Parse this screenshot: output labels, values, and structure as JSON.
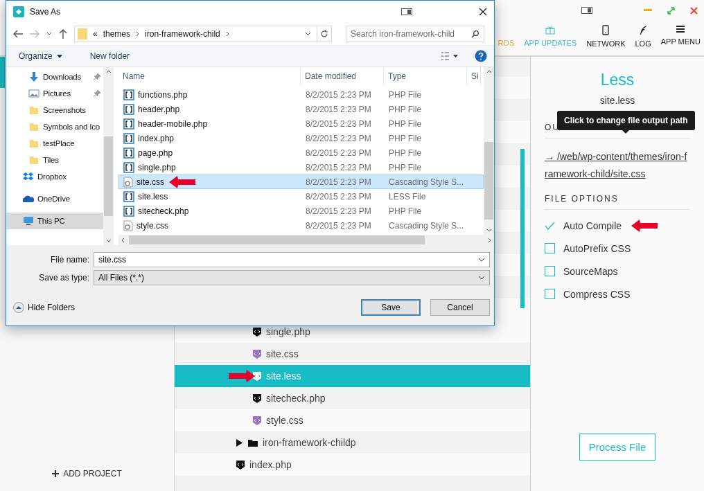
{
  "app": {
    "nav": [
      {
        "label": "ROS",
        "color": "#e0a43c"
      },
      {
        "label": "APP UPDATES",
        "color": "#3fbdc6"
      },
      {
        "label": "NETWORK",
        "color": "#222222"
      },
      {
        "label": "LOG",
        "color": "#222222"
      },
      {
        "label": "APP MENU",
        "color": "#222222"
      }
    ],
    "add_project": "ADD PROJECT",
    "tree": [
      {
        "children": [
          {
            "name": "single.php",
            "kind": "php",
            "selected": false,
            "annotated": false
          },
          {
            "name": "site.css",
            "kind": "css",
            "selected": false,
            "annotated": false
          },
          {
            "name": "site.less",
            "kind": "less",
            "selected": true,
            "annotated": true
          },
          {
            "name": "sitecheck.php",
            "kind": "php",
            "selected": false,
            "annotated": false
          },
          {
            "name": "style.css",
            "kind": "css",
            "selected": false,
            "annotated": false
          }
        ]
      },
      {
        "name": "iron-framework-childp",
        "kind": "folder",
        "expanded": false,
        "selected": false,
        "annotated": false
      },
      {
        "name": "index.php",
        "kind": "php",
        "selected": false,
        "annotated": false
      }
    ],
    "panel": {
      "title": "Less",
      "file": "site.less",
      "output_heading": "OU",
      "tooltip": "Click to change file output path",
      "output_path": "→ /web/wp-content/themes/iron-framework-child/site.css",
      "options_heading": "FILE OPTIONS",
      "options": [
        {
          "label": "Auto Compile",
          "checked": true,
          "annotated": true
        },
        {
          "label": "AutoPrefix CSS",
          "checked": false,
          "annotated": false
        },
        {
          "label": "SourceMaps",
          "checked": false,
          "annotated": false
        },
        {
          "label": "Compress CSS",
          "checked": false,
          "annotated": false
        }
      ],
      "process": "Process File"
    }
  },
  "dialog": {
    "title": "Save As",
    "breadcrumb": {
      "overflow": "«",
      "parts": [
        "themes",
        "iron-framework-child"
      ]
    },
    "search": {
      "placeholder": "Search iron-framework-child"
    },
    "organize": "Organize",
    "new_folder": "New folder",
    "places": [
      {
        "label": "Downloads",
        "kind": "download",
        "pinned": true,
        "selected": false
      },
      {
        "label": "Pictures",
        "kind": "pictures",
        "pinned": true,
        "selected": false
      },
      {
        "label": "Screenshots",
        "kind": "folder",
        "pinned": false,
        "selected": false
      },
      {
        "label": "Symbols and Ico",
        "kind": "folder",
        "pinned": false,
        "selected": false
      },
      {
        "label": "testPlace",
        "kind": "folder",
        "pinned": false,
        "selected": false
      },
      {
        "label": "Tiles",
        "kind": "folder",
        "pinned": false,
        "selected": false
      },
      {
        "label": "Dropbox",
        "kind": "dropbox",
        "pinned": false,
        "selected": false
      },
      {
        "label": "OneDrive",
        "kind": "cloud",
        "pinned": false,
        "selected": false
      },
      {
        "label": "This PC",
        "kind": "pc",
        "pinned": false,
        "selected": true
      }
    ],
    "columns": [
      "Name",
      "Date modified",
      "Type",
      "Si"
    ],
    "files": [
      {
        "name": "functions.php",
        "date": "8/2/2015 2:23 PM",
        "type": "PHP File",
        "kind": "code",
        "selected": false,
        "annotated": false
      },
      {
        "name": "header.php",
        "date": "8/2/2015 2:23 PM",
        "type": "PHP File",
        "kind": "code",
        "selected": false,
        "annotated": false
      },
      {
        "name": "header-mobile.php",
        "date": "8/2/2015 2:23 PM",
        "type": "PHP File",
        "kind": "code",
        "selected": false,
        "annotated": false
      },
      {
        "name": "index.php",
        "date": "8/2/2015 2:23 PM",
        "type": "PHP File",
        "kind": "code",
        "selected": false,
        "annotated": false
      },
      {
        "name": "page.php",
        "date": "8/2/2015 2:23 PM",
        "type": "PHP File",
        "kind": "code",
        "selected": false,
        "annotated": false
      },
      {
        "name": "single.php",
        "date": "8/2/2015 2:23 PM",
        "type": "PHP File",
        "kind": "code",
        "selected": false,
        "annotated": false
      },
      {
        "name": "site.css",
        "date": "8/2/2015 2:23 PM",
        "type": "Cascading Style S...",
        "kind": "css",
        "selected": true,
        "annotated": true
      },
      {
        "name": "site.less",
        "date": "8/2/2015 2:23 PM",
        "type": "LESS File",
        "kind": "code",
        "selected": false,
        "annotated": false
      },
      {
        "name": "sitecheck.php",
        "date": "8/2/2015 2:23 PM",
        "type": "PHP File",
        "kind": "code",
        "selected": false,
        "annotated": false
      },
      {
        "name": "style.css",
        "date": "8/2/2015 2:23 PM",
        "type": "Cascading Style S...",
        "kind": "css",
        "selected": false,
        "annotated": false
      }
    ],
    "file_name": {
      "label": "File name:",
      "value": "site.css"
    },
    "save_type": {
      "label": "Save as type:",
      "value": "All Files (*.*)"
    },
    "hide_folders": "Hide Folders",
    "buttons": [
      "Save",
      "Cancel"
    ]
  }
}
